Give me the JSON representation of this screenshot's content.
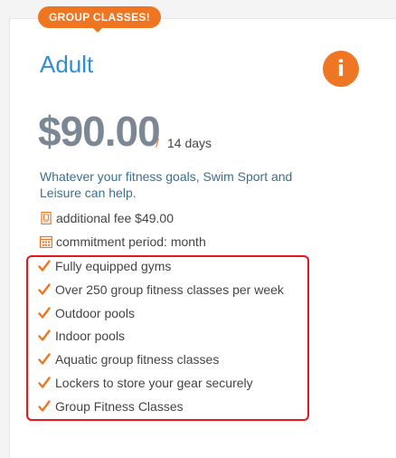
{
  "badge": {
    "label": "GROUP CLASSES!"
  },
  "plan": {
    "title": "Adult",
    "price": "$90.00",
    "separator": "/",
    "period": "14 days",
    "description": "Whatever your fitness goals, Swim Sport and Leisure can help."
  },
  "info_button": {
    "icon": "info-icon",
    "glyph": "i"
  },
  "meta": [
    {
      "icon": "fee-icon",
      "text": "additional fee $49.00"
    },
    {
      "icon": "calendar-icon",
      "text": "commitment period: month"
    }
  ],
  "features": [
    {
      "text": "Fully equipped gyms"
    },
    {
      "text": "Over 250 group fitness classes per week"
    },
    {
      "text": "Outdoor pools"
    },
    {
      "text": "Indoor pools"
    },
    {
      "text": "Aquatic group fitness classes"
    },
    {
      "text": "Lockers to store your gear securely"
    },
    {
      "text": "Group Fitness Classes"
    }
  ],
  "colors": {
    "accent": "#f07521",
    "title_blue": "#2e8fd0",
    "price_gray": "#7b8894",
    "highlight_red": "#e8141e"
  }
}
